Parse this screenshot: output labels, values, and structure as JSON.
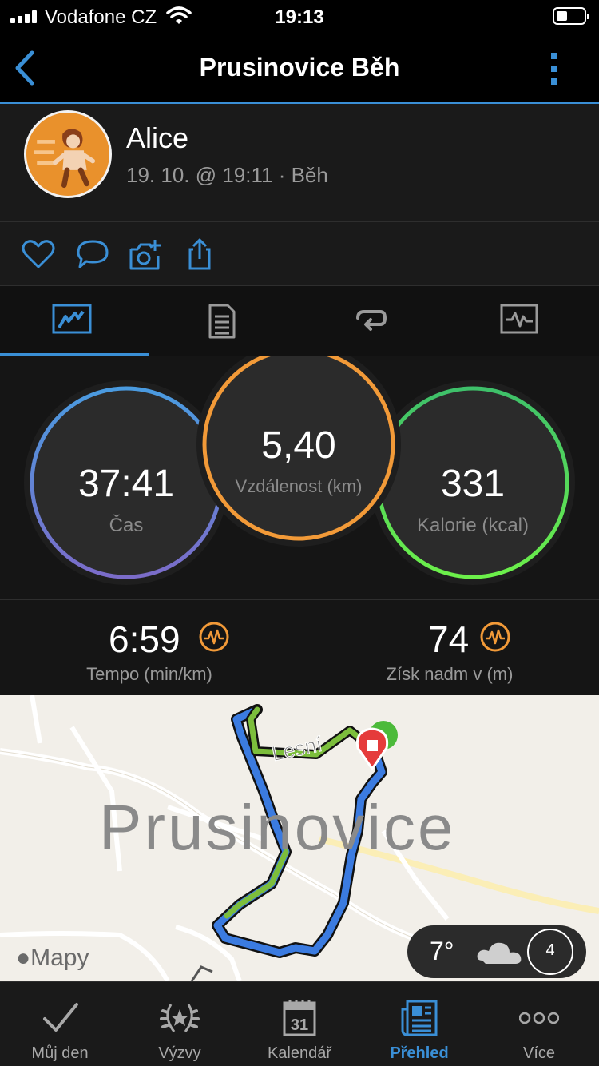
{
  "status": {
    "carrier": "Vodafone CZ",
    "time": "19:13"
  },
  "nav": {
    "title": "Prusinovice Běh"
  },
  "profile": {
    "name": "Alice",
    "meta": "19. 10. @ 19:11 · Běh"
  },
  "tabs": {
    "active_index": 0
  },
  "stats": {
    "time": {
      "value": "37:41",
      "label": "Čas"
    },
    "distance": {
      "value": "5,40",
      "label": "Vzdálenost (km)"
    },
    "calories": {
      "value": "331",
      "label": "Kalorie (kcal)"
    }
  },
  "metrics": {
    "pace": {
      "value": "6:59",
      "label": "Tempo (min/km)"
    },
    "elevation": {
      "value": "74",
      "label": "Získ nadm v (m)"
    }
  },
  "map": {
    "town": "Prusinovice",
    "street": "Lesní",
    "attribution": "Mapy",
    "weather": {
      "temp": "7°",
      "wind": "4"
    }
  },
  "bottom_nav": [
    {
      "label": "Můj den"
    },
    {
      "label": "Výzvy"
    },
    {
      "label": "Kalendář",
      "icon_text": "31"
    },
    {
      "label": "Přehled",
      "active": true
    },
    {
      "label": "Více"
    }
  ],
  "colors": {
    "accent": "#3a8fd6",
    "orange": "#f29a38",
    "green": "#5de35a",
    "purple": "#7b6cc9"
  }
}
